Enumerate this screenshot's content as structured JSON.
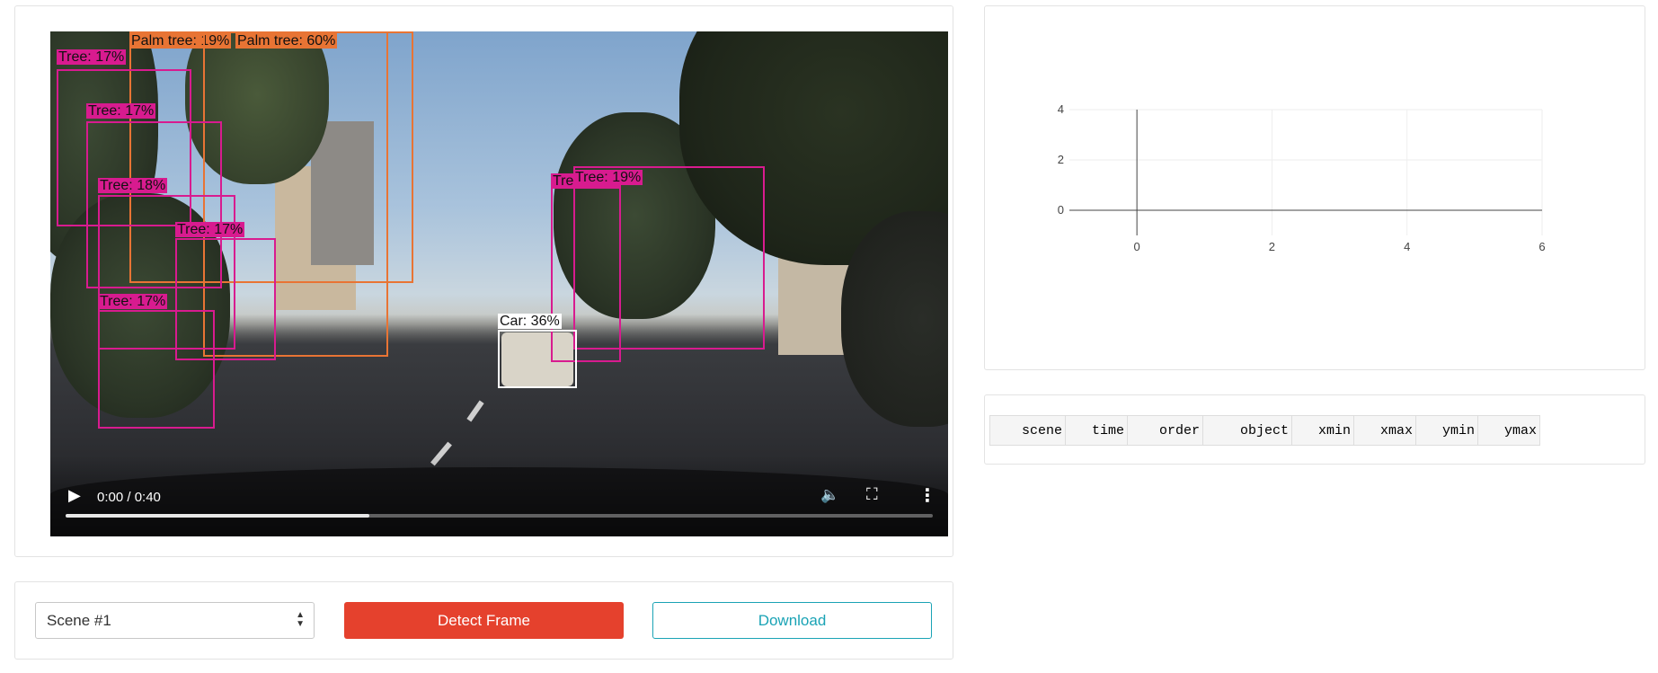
{
  "video": {
    "time_display": "0:00 / 0:40",
    "progress_fraction": 0.35,
    "detections": [
      {
        "label": "Palm tree: 19%",
        "color": "#e87434"
      },
      {
        "label": "Palm tree: 60%",
        "color": "#e87434"
      },
      {
        "label": "Tree: 17%",
        "color": "#d81b8f"
      },
      {
        "label": "Tree: 17%",
        "color": "#d81b8f"
      },
      {
        "label": "Tree: 18%",
        "color": "#d81b8f"
      },
      {
        "label": "Tree: 17%",
        "color": "#d81b8f"
      },
      {
        "label": "Tree: 17%",
        "color": "#d81b8f"
      },
      {
        "label": "Tree: 18%",
        "color": "#d81b8f"
      },
      {
        "label": "Tree: 19%",
        "color": "#d81b8f"
      },
      {
        "label": "Car: 36%",
        "color": "#ffffff"
      }
    ]
  },
  "chart_data": {
    "type": "scatter",
    "title": "",
    "xlabel": "",
    "ylabel": "",
    "xlim": [
      -1,
      6
    ],
    "ylim": [
      -1,
      4
    ],
    "x_ticks": [
      0,
      2,
      4,
      6
    ],
    "y_ticks": [
      0,
      2,
      4
    ],
    "grid": true,
    "series": []
  },
  "table": {
    "columns": [
      "scene",
      "time",
      "order",
      "object",
      "xmin",
      "xmax",
      "ymin",
      "ymax"
    ]
  },
  "controls": {
    "scene_value": "Scene #1",
    "detect_label": "Detect Frame",
    "download_label": "Download"
  }
}
